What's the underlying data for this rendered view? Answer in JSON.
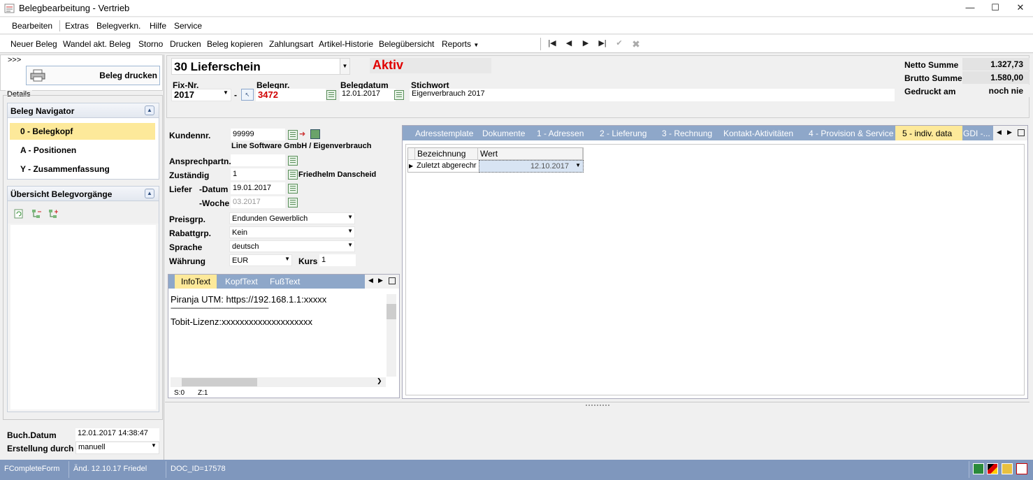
{
  "window": {
    "title": "Belegbearbeitung - Vertrieb"
  },
  "menu": [
    "Bearbeiten",
    "Extras",
    "Belegverkn.",
    "Hilfe",
    "Service"
  ],
  "toolbar": {
    "items": [
      "Neuer Beleg",
      "Wandel akt. Beleg",
      "Storno",
      "Drucken",
      "Beleg kopieren",
      "Zahlungsart",
      "Artikel-Historie",
      "Belegübersicht",
      "Reports"
    ]
  },
  "left": {
    "collapse_hint": ">>>",
    "print_label": "Beleg drucken",
    "details_label": "Details",
    "navigator_title": "Beleg Navigator",
    "nav_items": [
      "0 - Belegkopf",
      "A - Positionen",
      "Y - Zusammenfassung"
    ],
    "overview_title": "Übersicht Belegvorgänge",
    "buch_datum_label": "Buch.Datum",
    "buch_datum": "12.01.2017 14:38:47",
    "erstellung_label": "Erstellung durch",
    "erstellung": "manuell"
  },
  "header": {
    "doc_type": "30 Lieferschein",
    "status": "Aktiv",
    "fix_nr_label": "Fix-Nr.",
    "fix_nr": "2017",
    "dash": "-",
    "belegnr_label": "Belegnr.",
    "belegnr": "3472",
    "belegdatum_label": "Belegdatum",
    "belegdatum": "12.01.2017",
    "stichwort_label": "Stichwort",
    "stichwort": "Eigenverbrauch 2017",
    "netto_label": "Netto Summe",
    "netto": "1.327,73",
    "brutto_label": "Brutto Summe",
    "brutto": "1.580,00",
    "gedruckt_label": "Gedruckt am",
    "gedruckt": "noch nie"
  },
  "form": {
    "kundennr_label": "Kundennr.",
    "kundennr": "99999",
    "kunde_name": "Line Software GmbH / Eigenverbrauch",
    "ansprech_label": "Ansprechpartn.",
    "zustaendig_label": "Zuständig",
    "zustaendig": "1",
    "zustaendig_name": "Friedhelm Danscheid",
    "liefer_label": "Liefer",
    "datum_label": "-Datum",
    "datum": "19.01.2017",
    "woche_label": "-Woche",
    "woche": "03.2017",
    "preisgrp_label": "Preisgrp.",
    "preisgrp": "Endunden Gewerblich",
    "rabattgrp_label": "Rabattgrp.",
    "rabattgrp": "Kein",
    "sprache_label": "Sprache",
    "sprache": "deutsch",
    "waehrung_label": "Währung",
    "waehrung": "EUR",
    "kurs_label": "Kurs",
    "kurs": "1"
  },
  "text_tabs": {
    "tabs": [
      "InfoText",
      "KopfText",
      "FußText"
    ],
    "lines": [
      "Piranja UTM: https://192.168.1.1:xxxxx",
      "------------------------------------------------------------",
      "Tobit-Lizenz:xxxxxxxxxxxxxxxxxxxx"
    ],
    "status_s": "S:0",
    "status_z": "Z:1"
  },
  "right_tabs": {
    "tabs": [
      "Adresstemplate",
      "Dokumente",
      "1 - Adressen",
      "2 - Lieferung",
      "3 - Rechnung",
      "Kontakt-Aktivitäten",
      "4 - Provision & Service",
      "5 - indiv. data",
      "GDI -..."
    ]
  },
  "grid": {
    "headers": [
      "Bezeichnung",
      "Wert"
    ],
    "row": {
      "bezeichnung": "Zuletzt abgerechr",
      "wert": "12.10.2017"
    }
  },
  "status": {
    "form": "FCompleteForm",
    "changed": "Änd. 12.10.17 Friedel",
    "doc_id": "DOC_ID=17578"
  },
  "colors": {
    "accent_yellow": "#fde99a",
    "tab_blue": "#8ea7c9",
    "status_bar": "#7f97bd",
    "alert_red": "#e00000"
  }
}
